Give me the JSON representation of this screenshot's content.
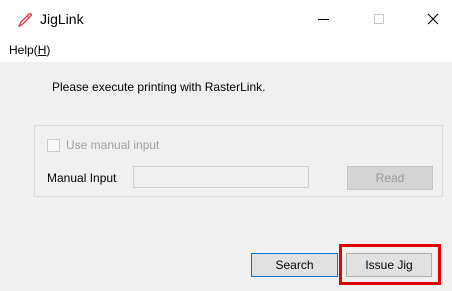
{
  "window": {
    "title": "JigLink",
    "minimize_glyph": "—",
    "close_glyph": "✕",
    "icon": "jiglink-pen-icon"
  },
  "menu": {
    "help_prefix": "Help(",
    "help_mnemonic": "H",
    "help_suffix": ")"
  },
  "main": {
    "message": "Please execute printing with RasterLink."
  },
  "manual_group": {
    "checkbox_label": "Use manual input",
    "checkbox_checked": false,
    "field_label": "Manual Input",
    "field_value": "",
    "read_button": "Read"
  },
  "footer": {
    "search_button": "Search",
    "issue_jig_button": "Issue Jig"
  },
  "colors": {
    "highlight": "#e20000",
    "focus_border": "#0078d7"
  }
}
